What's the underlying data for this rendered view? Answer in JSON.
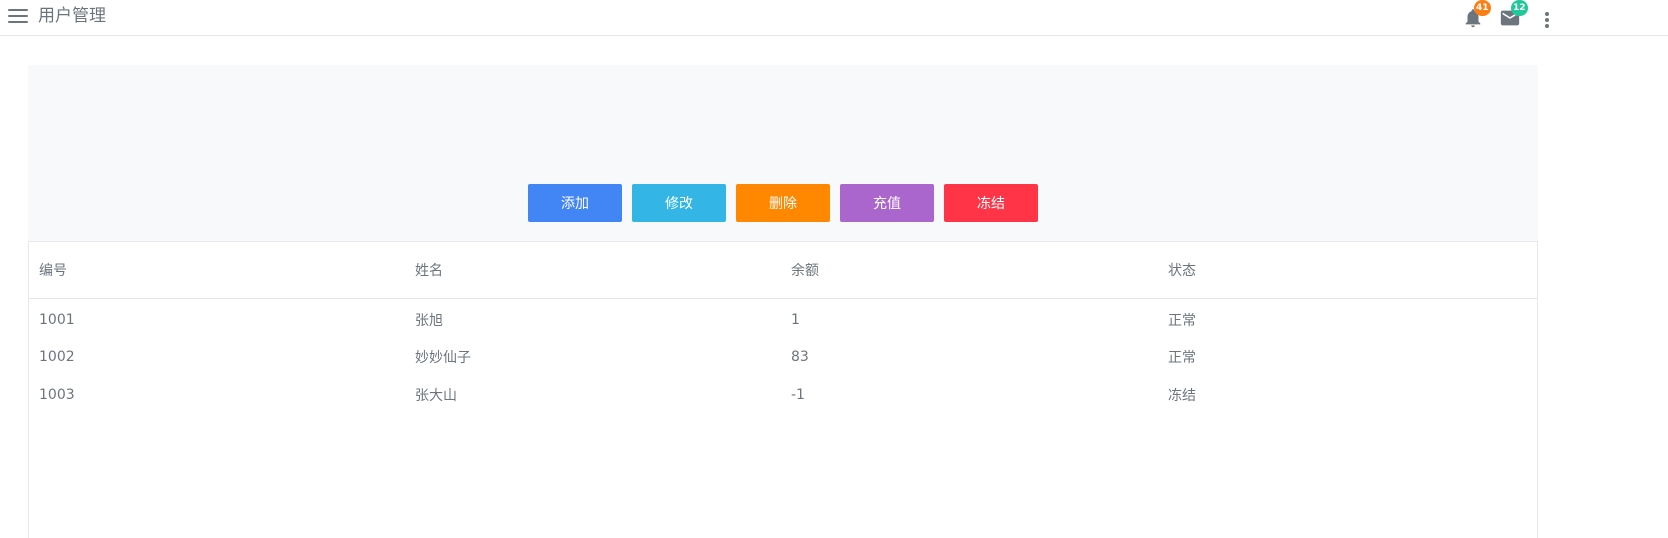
{
  "header": {
    "title": "用户管理",
    "notifications_count": "41",
    "messages_count": "12",
    "notification_badge_color": "#fd7e14",
    "message_badge_color": "#20c997",
    "icons": [
      "menu-icon",
      "bell-icon",
      "envelope-icon",
      "more-vertical-icon"
    ]
  },
  "toolbar": {
    "add_label": "添加",
    "edit_label": "修改",
    "delete_label": "删除",
    "recharge_label": "充值",
    "freeze_label": "冻结",
    "colors": {
      "add": "#4285f4",
      "edit": "#33b5e5",
      "delete": "#ff8800",
      "recharge": "#aa66cc",
      "freeze": "#ff3547"
    }
  },
  "table": {
    "columns": [
      "编号",
      "姓名",
      "余额",
      "状态"
    ],
    "rows": [
      [
        "1001",
        "张旭",
        "1",
        "正常"
      ],
      [
        "1002",
        "妙妙仙子",
        "83",
        "正常"
      ],
      [
        "1003",
        "张大山",
        "-1",
        "冻结"
      ]
    ]
  }
}
